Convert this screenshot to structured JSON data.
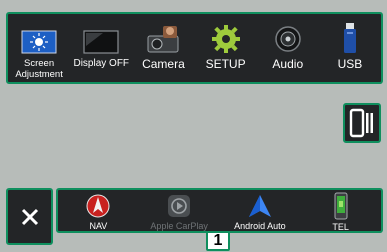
{
  "top_bar": {
    "tiles": [
      {
        "label_line1": "Screen",
        "label_line2": "Adjustment",
        "icon": "screen-adjust-icon"
      },
      {
        "label": "Display OFF",
        "icon": "display-off-icon"
      },
      {
        "label": "Camera",
        "icon": "camera-icon"
      },
      {
        "label": "SETUP",
        "icon": "gear-icon"
      },
      {
        "label": "Audio",
        "icon": "speaker-icon"
      },
      {
        "label": "USB",
        "icon": "usb-icon"
      }
    ]
  },
  "side": {
    "phone_icon": "phone-mirror-icon"
  },
  "bottom_bar": {
    "close_icon": "close-icon",
    "apps": [
      {
        "label": "NAV",
        "icon": "nav-icon"
      },
      {
        "label": "Apple CarPlay",
        "icon": "carplay-icon",
        "dimmed": true
      },
      {
        "label": "Android Auto",
        "icon": "android-auto-icon"
      },
      {
        "label": "TEL",
        "icon": "phone-icon"
      }
    ]
  },
  "callout": {
    "number": "1"
  },
  "colors": {
    "frame": "#0f8f5e",
    "panel": "#232527",
    "background": "#b7bcb9"
  }
}
